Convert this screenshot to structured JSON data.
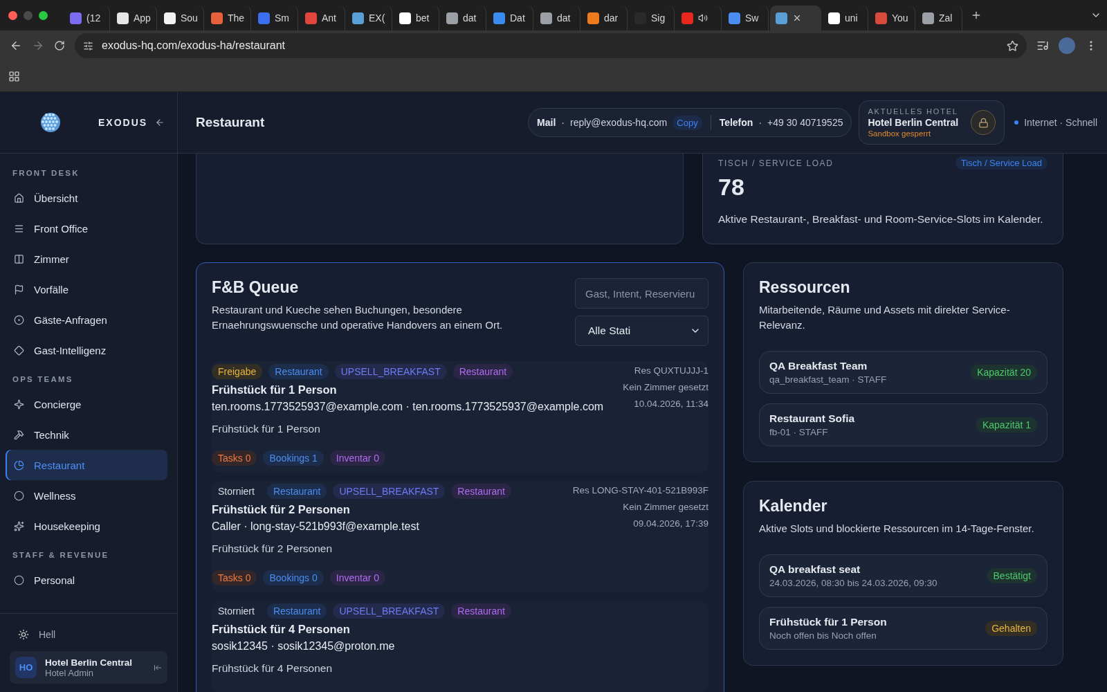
{
  "browser": {
    "tabs": [
      {
        "label": "(12",
        "color": "#7b6cf0",
        "selected": false
      },
      {
        "label": "App",
        "color": "#e6e6e6",
        "selected": false
      },
      {
        "label": "Sou",
        "color": "#f2f2f2",
        "selected": false
      },
      {
        "label": "The",
        "color": "#e8603c",
        "selected": false
      },
      {
        "label": "Sm",
        "color": "#3b6ff0",
        "selected": false
      },
      {
        "label": "Ant",
        "color": "#e0463c",
        "selected": false
      },
      {
        "label": "EX(",
        "color": "#5aa0d8",
        "selected": false
      },
      {
        "label": "bet",
        "color": "#ffffff",
        "selected": false
      },
      {
        "label": "dat",
        "color": "#9aa0a6",
        "selected": false
      },
      {
        "label": "Dat",
        "color": "#3b8cf0",
        "selected": false
      },
      {
        "label": "dat",
        "color": "#9aa0a6",
        "selected": false
      },
      {
        "label": "dar",
        "color": "#f07a1c",
        "selected": false
      },
      {
        "label": "Sig",
        "color": "#2a2a2a",
        "selected": false
      },
      {
        "color": "#e8281c",
        "audio": true,
        "selected": false
      },
      {
        "label": "Sw",
        "color": "#4a8cf0",
        "selected": false
      },
      {
        "color": "#5aa0d8",
        "selected": true
      },
      {
        "label": "uni",
        "color": "#ffffff",
        "selected": false
      },
      {
        "label": "You",
        "color": "#d84a3c",
        "selected": false
      },
      {
        "label": "Zal",
        "color": "#9aa0a6",
        "selected": false
      }
    ],
    "url": "exodus-hq.com/exodus-ha/restaurant"
  },
  "sidebar": {
    "brand": "EXODUS",
    "sections": [
      {
        "heading": "FRONT DESK",
        "items": [
          {
            "label": "Übersicht",
            "kind": "home",
            "selected": false
          },
          {
            "label": "Front Office",
            "kind": "list",
            "selected": false
          },
          {
            "label": "Zimmer",
            "kind": "room",
            "selected": false
          },
          {
            "label": "Vorfälle",
            "kind": "flag",
            "selected": false
          },
          {
            "label": "Gäste-Anfragen",
            "kind": "target",
            "selected": false
          },
          {
            "label": "Gast-Intelligenz",
            "kind": "diamond",
            "selected": false
          }
        ]
      },
      {
        "heading": "OPS TEAMS",
        "items": [
          {
            "label": "Concierge",
            "kind": "sparkle",
            "selected": false
          },
          {
            "label": "Technik",
            "kind": "tools",
            "selected": false
          },
          {
            "label": "Restaurant",
            "kind": "pie",
            "selected": true
          },
          {
            "label": "Wellness",
            "kind": "circle",
            "selected": false
          },
          {
            "label": "Housekeeping",
            "kind": "star",
            "selected": false
          }
        ]
      },
      {
        "heading": "STAFF & REVENUE",
        "items": [
          {
            "label": "Personal",
            "kind": "circle",
            "selected": false
          }
        ]
      }
    ],
    "theme_toggle": "Hell",
    "account": {
      "initials": "HO",
      "name": "Hotel Berlin Central",
      "role": "Hotel Admin"
    }
  },
  "header": {
    "title": "Restaurant",
    "contact": {
      "mail_label": "Mail",
      "mail": "reply@exodus-hq.com",
      "copy": "Copy",
      "separator": "·",
      "phone_label": "Telefon",
      "phone": "+49 30 40719525"
    },
    "hotel": {
      "label": "AKTUELLES HOTEL",
      "name": "Hotel Berlin Central",
      "status": "Sandbox gesperrt"
    },
    "connection": "Internet · Schnell"
  },
  "load_card": {
    "label": "TISCH / SERVICE LOAD",
    "badge": "Tisch / Service Load",
    "value": "78",
    "description": "Aktive Restaurant-, Breakfast- und Room-Service-Slots im Kalender."
  },
  "queue": {
    "title": "F&B Queue",
    "description": "Restaurant und Kueche sehen Buchungen, besondere Ernaehrungswuensche und operative Handovers an einem Ort.",
    "search": {
      "placeholder": "Gast, Intent, Reservieru"
    },
    "filter": "Alle Stati",
    "items": [
      {
        "status": {
          "label": "Freigabe",
          "kind": "approved"
        },
        "tags": [
          {
            "label": "Restaurant",
            "kind": "department"
          },
          {
            "label": "UPSELL_BREAKFAST",
            "kind": "intent"
          },
          {
            "label": "Restaurant",
            "kind": "outlet"
          }
        ],
        "title": "Frühstück für 1 Person",
        "contact": "ten.rooms.1773525937@example.com · ten.rooms.1773525937@example.com",
        "note": "Frühstück für 1 Person",
        "counters": [
          {
            "label": "Tasks 0",
            "kind": "tasks"
          },
          {
            "label": "Bookings 1",
            "kind": "bookings"
          },
          {
            "label": "Inventar 0",
            "kind": "inventory"
          }
        ],
        "reservation": "Res QUXTUJJJ-1",
        "room": "Kein Zimmer gesetzt",
        "time": "10.04.2026, 11:34"
      },
      {
        "status": {
          "label": "Storniert",
          "kind": "cancelled"
        },
        "tags": [
          {
            "label": "Restaurant",
            "kind": "department"
          },
          {
            "label": "UPSELL_BREAKFAST",
            "kind": "intent"
          },
          {
            "label": "Restaurant",
            "kind": "outlet"
          }
        ],
        "title": "Frühstück für 2 Personen",
        "contact": "Caller · long-stay-521b993f@example.test",
        "note": "Frühstück für 2 Personen",
        "counters": [
          {
            "label": "Tasks 0",
            "kind": "tasks"
          },
          {
            "label": "Bookings 0",
            "kind": "bookings"
          },
          {
            "label": "Inventar 0",
            "kind": "inventory"
          }
        ],
        "reservation": "Res LONG-STAY-401-521B993F",
        "room": "Kein Zimmer gesetzt",
        "time": "09.04.2026, 17:39"
      },
      {
        "status": {
          "label": "Storniert",
          "kind": "cancelled"
        },
        "tags": [
          {
            "label": "Restaurant",
            "kind": "department"
          },
          {
            "label": "UPSELL_BREAKFAST",
            "kind": "intent"
          },
          {
            "label": "Restaurant",
            "kind": "outlet"
          }
        ],
        "title": "Frühstück für 4 Personen",
        "contact": "sosik12345 · sosik12345@proton.me",
        "note": "Frühstück für 4 Personen"
      }
    ]
  },
  "resources": {
    "title": "Ressourcen",
    "description": "Mitarbeitende, Räume und Assets mit direkter Service-Relevanz.",
    "items": [
      {
        "name": "QA Breakfast Team",
        "meta": "qa_breakfast_team · STAFF",
        "badge": {
          "label": "Kapazität 20",
          "kind": "capacity"
        }
      },
      {
        "name": "Restaurant Sofia",
        "meta": "fb-01 · STAFF",
        "badge": {
          "label": "Kapazität 1",
          "kind": "capacity"
        }
      }
    ]
  },
  "calendar": {
    "title": "Kalender",
    "description": "Aktive Slots und blockierte Ressourcen im 14-Tage-Fenster.",
    "items": [
      {
        "name": "QA breakfast seat",
        "meta": "24.03.2026, 08:30 bis 24.03.2026, 09:30",
        "badge": {
          "label": "Bestätigt",
          "kind": "confirmed"
        }
      },
      {
        "name": "Frühstück für 1 Person",
        "meta": "Noch offen bis Noch offen",
        "badge": {
          "label": "Gehalten",
          "kind": "held"
        }
      }
    ]
  }
}
